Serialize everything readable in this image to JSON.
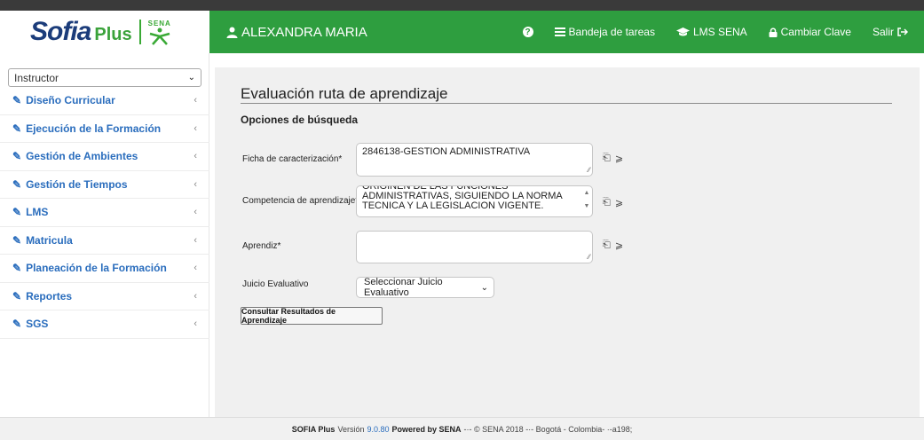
{
  "brand": {
    "name": "Sofia",
    "suffix": "Plus",
    "partner": "SENA"
  },
  "header": {
    "user": "ALEXANDRA MARIA",
    "help": "?",
    "tasks": "Bandeja de tareas",
    "lms": "LMS SENA",
    "change_password": "Cambiar Clave",
    "logout": "Salir"
  },
  "sidebar": {
    "role": "Instructor",
    "items": [
      {
        "label": "Diseño Curricular"
      },
      {
        "label": "Ejecución de la Formación"
      },
      {
        "label": "Gestión de Ambientes"
      },
      {
        "label": "Gestión de Tiempos"
      },
      {
        "label": "LMS"
      },
      {
        "label": "Matricula"
      },
      {
        "label": "Planeación de la Formación"
      },
      {
        "label": "Reportes"
      },
      {
        "label": "SGS"
      }
    ]
  },
  "main": {
    "title": "Evaluación ruta de aprendizaje",
    "subtitle": "Opciones de búsqueda",
    "ficha_label": "Ficha de caracterización*",
    "ficha_value": "2846138-GESTION ADMINISTRATIVA",
    "competencia_label": "Competencia de aprendizaje*",
    "competencia_value": "ORIGINEN DE LAS FUNCIONES ADMINISTRATIVAS, SIGUIENDO LA NORMA TECNICA Y LA LEGISLACION VIGENTE.",
    "aprendiz_label": "Aprendiz*",
    "aprendiz_value": "",
    "juicio_label": "Juicio Evaluativo",
    "juicio_value": "Seleccionar Juicio Evaluativo",
    "consult_button": "Consultar Resultados de Aprendizaje"
  },
  "footer": {
    "brand": "SOFIA Plus",
    "version_prefix": "Versión",
    "version": "9.0.80",
    "powered": "Powered by SENA",
    "rest": "-·- © SENA 2018 -·- Bogotá - Colombia- ·-a198;"
  },
  "colors": {
    "header_green": "#2e9e3f",
    "link_blue": "#2a6dbd",
    "brand_navy": "#1b3c7a"
  }
}
